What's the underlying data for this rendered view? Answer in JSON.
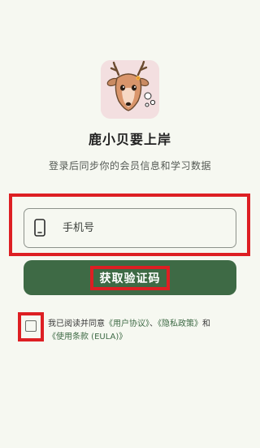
{
  "app": {
    "title": "鹿小贝要上岸",
    "subtitle": "登录后同步你的会员信息和学习数据"
  },
  "login": {
    "phone_placeholder": "手机号",
    "get_code_label": "获取验证码"
  },
  "agreement": {
    "prefix": "我已阅读并同意",
    "user_agreement": "《用户协议》",
    "separator": "、",
    "privacy_policy": "《隐私政策》",
    "and": "和",
    "eula": "《使用条款 (EULA)》"
  },
  "colors": {
    "background": "#f6f8f1",
    "primary": "#3e6a45",
    "highlight": "#dd1f23",
    "logo_bg": "#f3dfe0"
  },
  "icons": {
    "logo": "deer-logo-icon",
    "phone": "phone-icon",
    "checkbox": "checkbox-unchecked-icon"
  }
}
